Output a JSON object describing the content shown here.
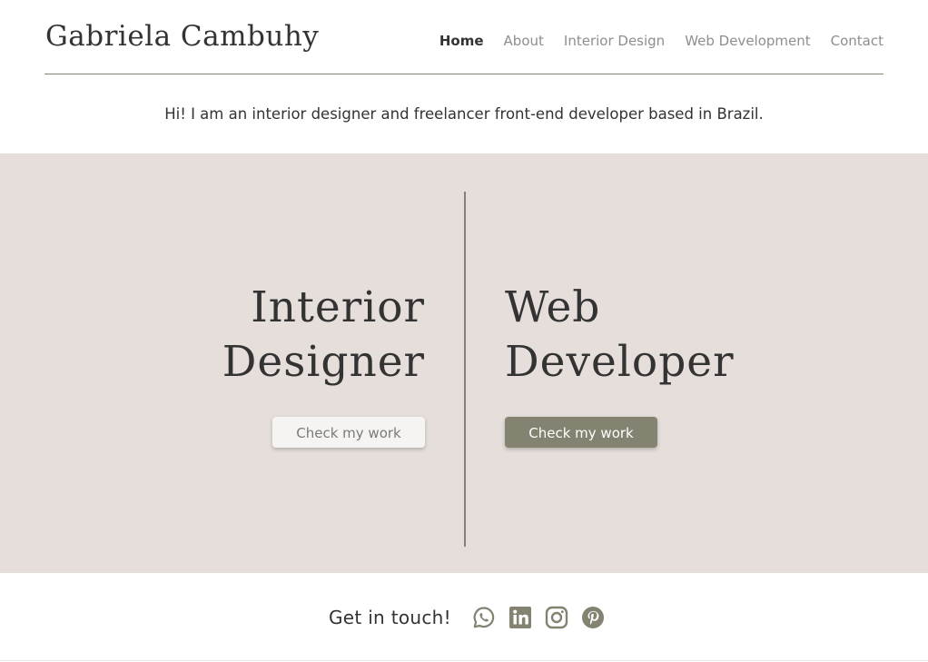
{
  "header": {
    "site_title": "Gabriela Cambuhy",
    "nav": [
      {
        "label": "Home",
        "active": true
      },
      {
        "label": "About",
        "active": false
      },
      {
        "label": "Interior Design",
        "active": false
      },
      {
        "label": "Web Development",
        "active": false
      },
      {
        "label": "Contact",
        "active": false
      }
    ]
  },
  "intro": {
    "text": "Hi! I am an interior designer and freelancer front-end developer based in Brazil."
  },
  "hero": {
    "left": {
      "role_line1": "Interior",
      "role_line2": "Designer",
      "button_label": "Check my work"
    },
    "right": {
      "role_line1": "Web",
      "role_line2": "Developer",
      "button_label": "Check my work"
    }
  },
  "footer": {
    "touch_label": "Get in touch!",
    "social_icons": [
      "whatsapp-icon",
      "linkedin-icon",
      "instagram-icon",
      "pinterest-icon"
    ]
  },
  "colors": {
    "accent": "#848271",
    "hero_bg": "#e5deda",
    "text": "#333333",
    "nav_muted": "#8e8e8e"
  }
}
